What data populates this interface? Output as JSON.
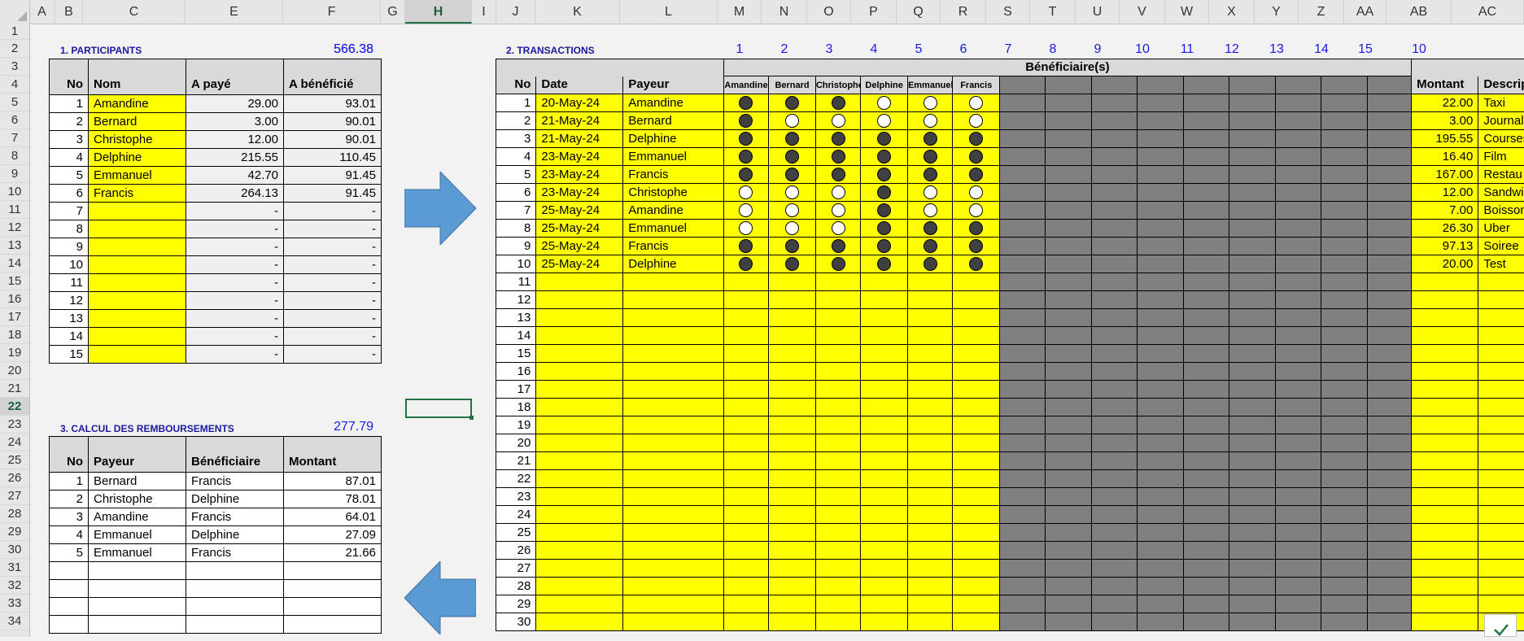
{
  "columns": [
    "A",
    "B",
    "C",
    "E",
    "F",
    "G",
    "H",
    "I",
    "J",
    "K",
    "L",
    "M",
    "N",
    "O",
    "P",
    "Q",
    "R",
    "S",
    "T",
    "U",
    "V",
    "W",
    "X",
    "Y",
    "Z",
    "AA",
    "AB",
    "AC"
  ],
  "selected_column": "H",
  "rows": [
    1,
    2,
    3,
    4,
    5,
    6,
    7,
    8,
    9,
    10,
    11,
    12,
    13,
    14,
    15,
    16,
    17,
    18,
    19,
    20,
    21,
    22,
    23,
    24,
    25,
    26,
    27,
    28,
    29,
    30,
    31,
    32,
    33,
    34
  ],
  "selected_row": 22,
  "participants": {
    "title": "1. PARTICIPANTS",
    "total_paid": "566.38",
    "total_benefited": "566.38",
    "headers": [
      "No",
      "Nom",
      "A payé",
      "A bénéficié"
    ],
    "rows": [
      {
        "no": "1",
        "nom": "Amandine",
        "paye": "29.00",
        "benef": "93.01"
      },
      {
        "no": "2",
        "nom": "Bernard",
        "paye": "3.00",
        "benef": "90.01"
      },
      {
        "no": "3",
        "nom": "Christophe",
        "paye": "12.00",
        "benef": "90.01"
      },
      {
        "no": "4",
        "nom": "Delphine",
        "paye": "215.55",
        "benef": "110.45"
      },
      {
        "no": "5",
        "nom": "Emmanuel",
        "paye": "42.70",
        "benef": "91.45"
      },
      {
        "no": "6",
        "nom": "Francis",
        "paye": "264.13",
        "benef": "91.45"
      },
      {
        "no": "7",
        "nom": "",
        "paye": "-",
        "benef": "-"
      },
      {
        "no": "8",
        "nom": "",
        "paye": "-",
        "benef": "-"
      },
      {
        "no": "9",
        "nom": "",
        "paye": "-",
        "benef": "-"
      },
      {
        "no": "10",
        "nom": "",
        "paye": "-",
        "benef": "-"
      },
      {
        "no": "11",
        "nom": "",
        "paye": "-",
        "benef": "-"
      },
      {
        "no": "12",
        "nom": "",
        "paye": "-",
        "benef": "-"
      },
      {
        "no": "13",
        "nom": "",
        "paye": "-",
        "benef": "-"
      },
      {
        "no": "14",
        "nom": "",
        "paye": "-",
        "benef": "-"
      },
      {
        "no": "15",
        "nom": "",
        "paye": "-",
        "benef": "-"
      }
    ]
  },
  "rembourse": {
    "title": "3. CALCUL DES REMBOURSEMENTS",
    "total": "277.79",
    "headers": [
      "No",
      "Payeur",
      "Bénéficiaire",
      "Montant"
    ],
    "rows": [
      {
        "no": "1",
        "payeur": "Bernard",
        "benef": "Francis",
        "montant": "87.01"
      },
      {
        "no": "2",
        "payeur": "Christophe",
        "benef": "Delphine",
        "montant": "78.01"
      },
      {
        "no": "3",
        "payeur": "Amandine",
        "benef": "Francis",
        "montant": "64.01"
      },
      {
        "no": "4",
        "payeur": "Emmanuel",
        "benef": "Delphine",
        "montant": "27.09"
      },
      {
        "no": "5",
        "payeur": "Emmanuel",
        "benef": "Francis",
        "montant": "21.66"
      }
    ],
    "empty_rows": 4
  },
  "transactions": {
    "title": "2. TRANSACTIONS",
    "col_numbers": [
      "1",
      "2",
      "3",
      "4",
      "5",
      "6",
      "7",
      "8",
      "9",
      "10",
      "11",
      "12",
      "13",
      "14",
      "15"
    ],
    "ab_number": "10",
    "beneficiaires_header": "Bénéficiaire(s)",
    "headers": {
      "no": "No",
      "date": "Date",
      "payeur": "Payeur",
      "montant": "Montant",
      "description": "Descriptio"
    },
    "beneficiary_names": [
      "Amandine",
      "Bernard",
      "Christophe",
      "Delphine",
      "Emmanuel",
      "Francis"
    ],
    "rows": [
      {
        "no": "1",
        "date": "20-May-24",
        "payeur": "Amandine",
        "b": [
          1,
          1,
          1,
          0,
          0,
          0
        ],
        "montant": "22.00",
        "desc": "Taxi"
      },
      {
        "no": "2",
        "date": "21-May-24",
        "payeur": "Bernard",
        "b": [
          1,
          0,
          0,
          0,
          0,
          0
        ],
        "montant": "3.00",
        "desc": "Journal"
      },
      {
        "no": "3",
        "date": "21-May-24",
        "payeur": "Delphine",
        "b": [
          1,
          1,
          1,
          1,
          1,
          1
        ],
        "montant": "195.55",
        "desc": "Courses"
      },
      {
        "no": "4",
        "date": "23-May-24",
        "payeur": "Emmanuel",
        "b": [
          1,
          1,
          1,
          1,
          1,
          1
        ],
        "montant": "16.40",
        "desc": "Film"
      },
      {
        "no": "5",
        "date": "23-May-24",
        "payeur": "Francis",
        "b": [
          1,
          1,
          1,
          1,
          1,
          1
        ],
        "montant": "167.00",
        "desc": "Restau"
      },
      {
        "no": "6",
        "date": "23-May-24",
        "payeur": "Christophe",
        "b": [
          0,
          0,
          0,
          1,
          0,
          0
        ],
        "montant": "12.00",
        "desc": "Sandwich"
      },
      {
        "no": "7",
        "date": "25-May-24",
        "payeur": "Amandine",
        "b": [
          0,
          0,
          0,
          1,
          0,
          0
        ],
        "montant": "7.00",
        "desc": "Boisson"
      },
      {
        "no": "8",
        "date": "25-May-24",
        "payeur": "Emmanuel",
        "b": [
          0,
          0,
          0,
          1,
          1,
          1
        ],
        "montant": "26.30",
        "desc": "Uber"
      },
      {
        "no": "9",
        "date": "25-May-24",
        "payeur": "Francis",
        "b": [
          1,
          1,
          1,
          1,
          1,
          1
        ],
        "montant": "97.13",
        "desc": "Soiree"
      },
      {
        "no": "10",
        "date": "25-May-24",
        "payeur": "Delphine",
        "b": [
          1,
          1,
          1,
          1,
          1,
          1
        ],
        "montant": "20.00",
        "desc": "Test"
      }
    ],
    "empty_row_numbers": [
      "11",
      "12",
      "13",
      "14",
      "15",
      "16",
      "17",
      "18",
      "19",
      "20",
      "21",
      "22",
      "23",
      "24",
      "25",
      "26",
      "27",
      "28",
      "29",
      "30"
    ]
  },
  "icons": {
    "arrow_right": "arrow-right-icon",
    "arrow_left": "arrow-left-icon",
    "check": "check-icon"
  },
  "colors": {
    "yellow": "#ffff00",
    "dark_gray": "#808080",
    "header_gray": "#d9d9d9",
    "arrow_blue": "#5b9bd5",
    "title_blue": "#1a1a9e"
  }
}
